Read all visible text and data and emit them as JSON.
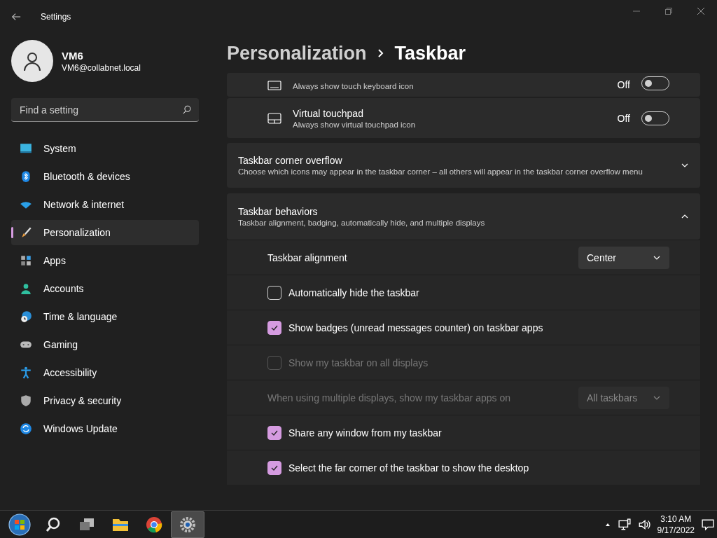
{
  "window": {
    "title": "Settings"
  },
  "user": {
    "name": "VM6",
    "email": "VM6@collabnet.local"
  },
  "search": {
    "placeholder": "Find a setting"
  },
  "nav": [
    {
      "label": "System",
      "selected": false
    },
    {
      "label": "Bluetooth & devices",
      "selected": false
    },
    {
      "label": "Network & internet",
      "selected": false
    },
    {
      "label": "Personalization",
      "selected": true
    },
    {
      "label": "Apps",
      "selected": false
    },
    {
      "label": "Accounts",
      "selected": false
    },
    {
      "label": "Time & language",
      "selected": false
    },
    {
      "label": "Gaming",
      "selected": false
    },
    {
      "label": "Accessibility",
      "selected": false
    },
    {
      "label": "Privacy & security",
      "selected": false
    },
    {
      "label": "Windows Update",
      "selected": false
    }
  ],
  "breadcrumb": [
    "Personalization",
    "Taskbar"
  ],
  "settings": [
    {
      "kind": "toggle",
      "subtitle": "Always show touch keyboard icon",
      "state_label": "Off",
      "on": false
    },
    {
      "kind": "toggle",
      "title": "Virtual touchpad",
      "subtitle": "Always show virtual touchpad icon",
      "state_label": "Off",
      "on": false
    },
    {
      "kind": "expander",
      "title": "Taskbar corner overflow",
      "subtitle": "Choose which icons may appear in the taskbar corner – all others will appear in the taskbar corner overflow menu",
      "expanded": false
    },
    {
      "kind": "expander",
      "title": "Taskbar behaviors",
      "subtitle": "Taskbar alignment, badging, automatically hide, and multiple displays",
      "expanded": true,
      "children": [
        {
          "kind": "dropdown",
          "label": "Taskbar alignment",
          "value": "Center",
          "disabled": false
        },
        {
          "kind": "checkbox",
          "label": "Automatically hide the taskbar",
          "checked": false,
          "disabled": false
        },
        {
          "kind": "checkbox",
          "label": "Show badges (unread messages counter) on taskbar apps",
          "checked": true,
          "disabled": false
        },
        {
          "kind": "checkbox",
          "label": "Show my taskbar on all displays",
          "checked": false,
          "disabled": true
        },
        {
          "kind": "dropdown",
          "label": "When using multiple displays, show my taskbar apps on",
          "value": "All taskbars",
          "disabled": true
        },
        {
          "kind": "checkbox",
          "label": "Share any window from my taskbar",
          "checked": true,
          "disabled": false
        },
        {
          "kind": "checkbox",
          "label": "Select the far corner of the taskbar to show the desktop",
          "checked": true,
          "disabled": false
        }
      ]
    }
  ],
  "taskbar": {
    "apps": [
      {
        "kind": "start",
        "selected": false
      },
      {
        "kind": "search",
        "selected": false
      },
      {
        "kind": "taskview",
        "selected": false
      },
      {
        "kind": "folder",
        "selected": false
      },
      {
        "kind": "browser",
        "selected": false
      },
      {
        "kind": "settings",
        "selected": true
      }
    ],
    "time": "3:10 AM",
    "date": "9/17/2022"
  }
}
